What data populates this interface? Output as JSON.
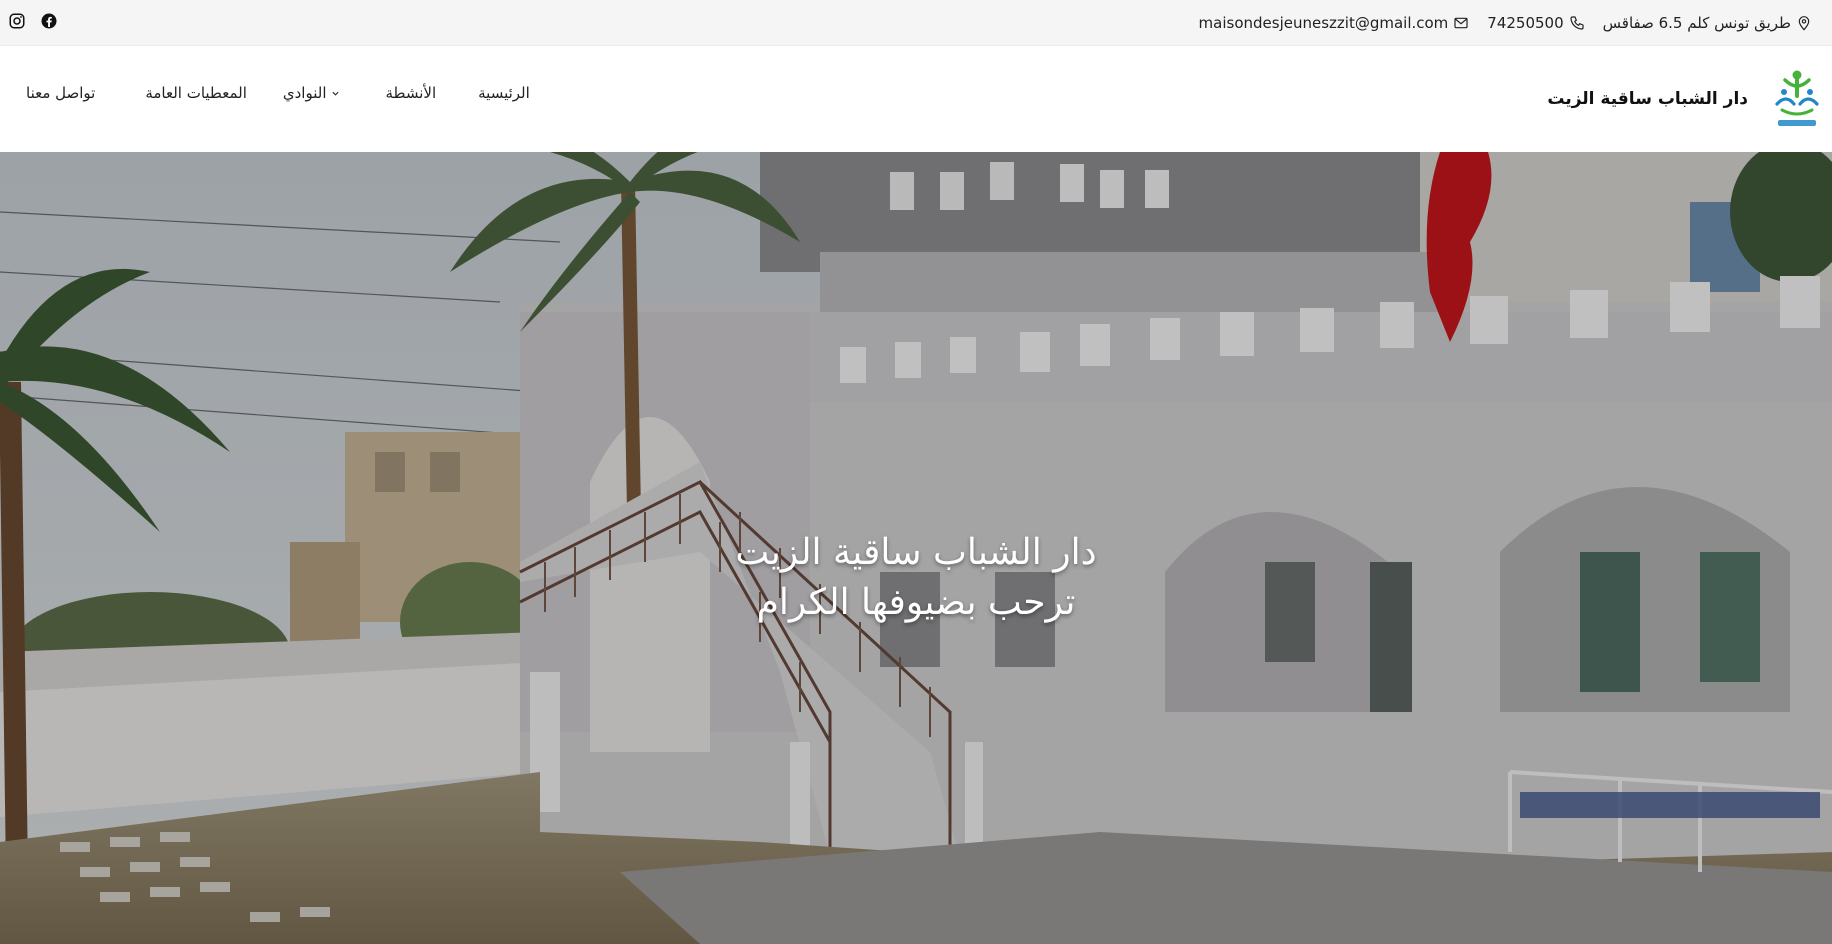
{
  "topbar": {
    "address": "طريق تونس كلم 6.5 صفاقس",
    "phone": "74250500",
    "email": "maisondesjeuneszzit@gmail.com",
    "social": [
      {
        "name": "instagram-icon"
      },
      {
        "name": "facebook-icon"
      }
    ]
  },
  "header": {
    "site_title": "دار الشباب ساقية الزيت",
    "logo_caption": "دار الشباب ساقية الزيت"
  },
  "nav": {
    "items": [
      {
        "label": "الرئيسية"
      },
      {
        "label": "الأنشطة"
      },
      {
        "label": "النوادي"
      },
      {
        "label": "المعطيات العامة"
      },
      {
        "label": "تواصل معنا"
      }
    ]
  },
  "hero": {
    "line1": "دار الشباب ساقية الزيت",
    "line2": "ترحب بضيوفها الكرام"
  },
  "colors": {
    "topbar_bg": "#f5f5f5",
    "flag": "#c8161d",
    "logo_green": "#46b23a",
    "logo_blue": "#1e88c8"
  }
}
